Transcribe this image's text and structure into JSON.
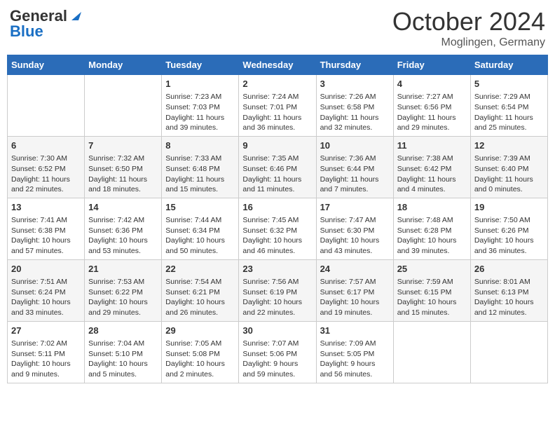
{
  "header": {
    "logo_line1": "General",
    "logo_line2": "Blue",
    "month": "October 2024",
    "location": "Moglingen, Germany"
  },
  "days_of_week": [
    "Sunday",
    "Monday",
    "Tuesday",
    "Wednesday",
    "Thursday",
    "Friday",
    "Saturday"
  ],
  "weeks": [
    [
      {
        "day": "",
        "info": ""
      },
      {
        "day": "",
        "info": ""
      },
      {
        "day": "1",
        "info": "Sunrise: 7:23 AM\nSunset: 7:03 PM\nDaylight: 11 hours and 39 minutes."
      },
      {
        "day": "2",
        "info": "Sunrise: 7:24 AM\nSunset: 7:01 PM\nDaylight: 11 hours and 36 minutes."
      },
      {
        "day": "3",
        "info": "Sunrise: 7:26 AM\nSunset: 6:58 PM\nDaylight: 11 hours and 32 minutes."
      },
      {
        "day": "4",
        "info": "Sunrise: 7:27 AM\nSunset: 6:56 PM\nDaylight: 11 hours and 29 minutes."
      },
      {
        "day": "5",
        "info": "Sunrise: 7:29 AM\nSunset: 6:54 PM\nDaylight: 11 hours and 25 minutes."
      }
    ],
    [
      {
        "day": "6",
        "info": "Sunrise: 7:30 AM\nSunset: 6:52 PM\nDaylight: 11 hours and 22 minutes."
      },
      {
        "day": "7",
        "info": "Sunrise: 7:32 AM\nSunset: 6:50 PM\nDaylight: 11 hours and 18 minutes."
      },
      {
        "day": "8",
        "info": "Sunrise: 7:33 AM\nSunset: 6:48 PM\nDaylight: 11 hours and 15 minutes."
      },
      {
        "day": "9",
        "info": "Sunrise: 7:35 AM\nSunset: 6:46 PM\nDaylight: 11 hours and 11 minutes."
      },
      {
        "day": "10",
        "info": "Sunrise: 7:36 AM\nSunset: 6:44 PM\nDaylight: 11 hours and 7 minutes."
      },
      {
        "day": "11",
        "info": "Sunrise: 7:38 AM\nSunset: 6:42 PM\nDaylight: 11 hours and 4 minutes."
      },
      {
        "day": "12",
        "info": "Sunrise: 7:39 AM\nSunset: 6:40 PM\nDaylight: 11 hours and 0 minutes."
      }
    ],
    [
      {
        "day": "13",
        "info": "Sunrise: 7:41 AM\nSunset: 6:38 PM\nDaylight: 10 hours and 57 minutes."
      },
      {
        "day": "14",
        "info": "Sunrise: 7:42 AM\nSunset: 6:36 PM\nDaylight: 10 hours and 53 minutes."
      },
      {
        "day": "15",
        "info": "Sunrise: 7:44 AM\nSunset: 6:34 PM\nDaylight: 10 hours and 50 minutes."
      },
      {
        "day": "16",
        "info": "Sunrise: 7:45 AM\nSunset: 6:32 PM\nDaylight: 10 hours and 46 minutes."
      },
      {
        "day": "17",
        "info": "Sunrise: 7:47 AM\nSunset: 6:30 PM\nDaylight: 10 hours and 43 minutes."
      },
      {
        "day": "18",
        "info": "Sunrise: 7:48 AM\nSunset: 6:28 PM\nDaylight: 10 hours and 39 minutes."
      },
      {
        "day": "19",
        "info": "Sunrise: 7:50 AM\nSunset: 6:26 PM\nDaylight: 10 hours and 36 minutes."
      }
    ],
    [
      {
        "day": "20",
        "info": "Sunrise: 7:51 AM\nSunset: 6:24 PM\nDaylight: 10 hours and 33 minutes."
      },
      {
        "day": "21",
        "info": "Sunrise: 7:53 AM\nSunset: 6:22 PM\nDaylight: 10 hours and 29 minutes."
      },
      {
        "day": "22",
        "info": "Sunrise: 7:54 AM\nSunset: 6:21 PM\nDaylight: 10 hours and 26 minutes."
      },
      {
        "day": "23",
        "info": "Sunrise: 7:56 AM\nSunset: 6:19 PM\nDaylight: 10 hours and 22 minutes."
      },
      {
        "day": "24",
        "info": "Sunrise: 7:57 AM\nSunset: 6:17 PM\nDaylight: 10 hours and 19 minutes."
      },
      {
        "day": "25",
        "info": "Sunrise: 7:59 AM\nSunset: 6:15 PM\nDaylight: 10 hours and 15 minutes."
      },
      {
        "day": "26",
        "info": "Sunrise: 8:01 AM\nSunset: 6:13 PM\nDaylight: 10 hours and 12 minutes."
      }
    ],
    [
      {
        "day": "27",
        "info": "Sunrise: 7:02 AM\nSunset: 5:11 PM\nDaylight: 10 hours and 9 minutes."
      },
      {
        "day": "28",
        "info": "Sunrise: 7:04 AM\nSunset: 5:10 PM\nDaylight: 10 hours and 5 minutes."
      },
      {
        "day": "29",
        "info": "Sunrise: 7:05 AM\nSunset: 5:08 PM\nDaylight: 10 hours and 2 minutes."
      },
      {
        "day": "30",
        "info": "Sunrise: 7:07 AM\nSunset: 5:06 PM\nDaylight: 9 hours and 59 minutes."
      },
      {
        "day": "31",
        "info": "Sunrise: 7:09 AM\nSunset: 5:05 PM\nDaylight: 9 hours and 56 minutes."
      },
      {
        "day": "",
        "info": ""
      },
      {
        "day": "",
        "info": ""
      }
    ]
  ]
}
